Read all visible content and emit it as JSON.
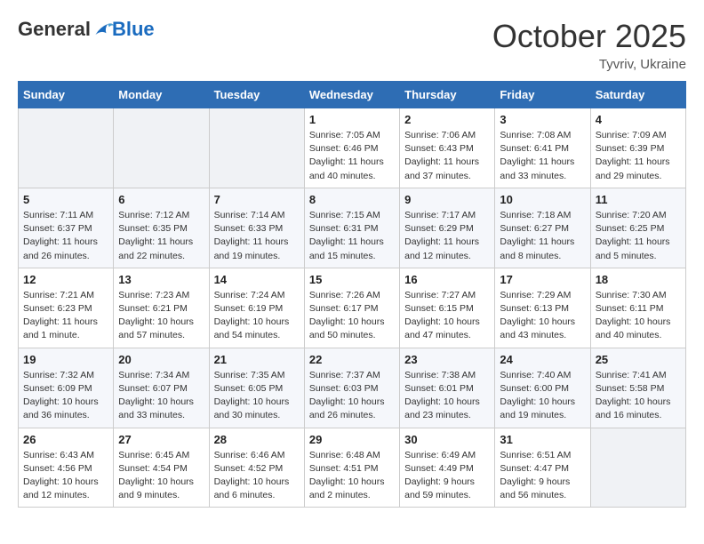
{
  "header": {
    "logo_general": "General",
    "logo_blue": "Blue",
    "month_year": "October 2025",
    "location": "Tyvriv, Ukraine"
  },
  "weekdays": [
    "Sunday",
    "Monday",
    "Tuesday",
    "Wednesday",
    "Thursday",
    "Friday",
    "Saturday"
  ],
  "weeks": [
    [
      {
        "day": "",
        "info": ""
      },
      {
        "day": "",
        "info": ""
      },
      {
        "day": "",
        "info": ""
      },
      {
        "day": "1",
        "info": "Sunrise: 7:05 AM\nSunset: 6:46 PM\nDaylight: 11 hours\nand 40 minutes."
      },
      {
        "day": "2",
        "info": "Sunrise: 7:06 AM\nSunset: 6:43 PM\nDaylight: 11 hours\nand 37 minutes."
      },
      {
        "day": "3",
        "info": "Sunrise: 7:08 AM\nSunset: 6:41 PM\nDaylight: 11 hours\nand 33 minutes."
      },
      {
        "day": "4",
        "info": "Sunrise: 7:09 AM\nSunset: 6:39 PM\nDaylight: 11 hours\nand 29 minutes."
      }
    ],
    [
      {
        "day": "5",
        "info": "Sunrise: 7:11 AM\nSunset: 6:37 PM\nDaylight: 11 hours\nand 26 minutes."
      },
      {
        "day": "6",
        "info": "Sunrise: 7:12 AM\nSunset: 6:35 PM\nDaylight: 11 hours\nand 22 minutes."
      },
      {
        "day": "7",
        "info": "Sunrise: 7:14 AM\nSunset: 6:33 PM\nDaylight: 11 hours\nand 19 minutes."
      },
      {
        "day": "8",
        "info": "Sunrise: 7:15 AM\nSunset: 6:31 PM\nDaylight: 11 hours\nand 15 minutes."
      },
      {
        "day": "9",
        "info": "Sunrise: 7:17 AM\nSunset: 6:29 PM\nDaylight: 11 hours\nand 12 minutes."
      },
      {
        "day": "10",
        "info": "Sunrise: 7:18 AM\nSunset: 6:27 PM\nDaylight: 11 hours\nand 8 minutes."
      },
      {
        "day": "11",
        "info": "Sunrise: 7:20 AM\nSunset: 6:25 PM\nDaylight: 11 hours\nand 5 minutes."
      }
    ],
    [
      {
        "day": "12",
        "info": "Sunrise: 7:21 AM\nSunset: 6:23 PM\nDaylight: 11 hours\nand 1 minute."
      },
      {
        "day": "13",
        "info": "Sunrise: 7:23 AM\nSunset: 6:21 PM\nDaylight: 10 hours\nand 57 minutes."
      },
      {
        "day": "14",
        "info": "Sunrise: 7:24 AM\nSunset: 6:19 PM\nDaylight: 10 hours\nand 54 minutes."
      },
      {
        "day": "15",
        "info": "Sunrise: 7:26 AM\nSunset: 6:17 PM\nDaylight: 10 hours\nand 50 minutes."
      },
      {
        "day": "16",
        "info": "Sunrise: 7:27 AM\nSunset: 6:15 PM\nDaylight: 10 hours\nand 47 minutes."
      },
      {
        "day": "17",
        "info": "Sunrise: 7:29 AM\nSunset: 6:13 PM\nDaylight: 10 hours\nand 43 minutes."
      },
      {
        "day": "18",
        "info": "Sunrise: 7:30 AM\nSunset: 6:11 PM\nDaylight: 10 hours\nand 40 minutes."
      }
    ],
    [
      {
        "day": "19",
        "info": "Sunrise: 7:32 AM\nSunset: 6:09 PM\nDaylight: 10 hours\nand 36 minutes."
      },
      {
        "day": "20",
        "info": "Sunrise: 7:34 AM\nSunset: 6:07 PM\nDaylight: 10 hours\nand 33 minutes."
      },
      {
        "day": "21",
        "info": "Sunrise: 7:35 AM\nSunset: 6:05 PM\nDaylight: 10 hours\nand 30 minutes."
      },
      {
        "day": "22",
        "info": "Sunrise: 7:37 AM\nSunset: 6:03 PM\nDaylight: 10 hours\nand 26 minutes."
      },
      {
        "day": "23",
        "info": "Sunrise: 7:38 AM\nSunset: 6:01 PM\nDaylight: 10 hours\nand 23 minutes."
      },
      {
        "day": "24",
        "info": "Sunrise: 7:40 AM\nSunset: 6:00 PM\nDaylight: 10 hours\nand 19 minutes."
      },
      {
        "day": "25",
        "info": "Sunrise: 7:41 AM\nSunset: 5:58 PM\nDaylight: 10 hours\nand 16 minutes."
      }
    ],
    [
      {
        "day": "26",
        "info": "Sunrise: 6:43 AM\nSunset: 4:56 PM\nDaylight: 10 hours\nand 12 minutes."
      },
      {
        "day": "27",
        "info": "Sunrise: 6:45 AM\nSunset: 4:54 PM\nDaylight: 10 hours\nand 9 minutes."
      },
      {
        "day": "28",
        "info": "Sunrise: 6:46 AM\nSunset: 4:52 PM\nDaylight: 10 hours\nand 6 minutes."
      },
      {
        "day": "29",
        "info": "Sunrise: 6:48 AM\nSunset: 4:51 PM\nDaylight: 10 hours\nand 2 minutes."
      },
      {
        "day": "30",
        "info": "Sunrise: 6:49 AM\nSunset: 4:49 PM\nDaylight: 9 hours\nand 59 minutes."
      },
      {
        "day": "31",
        "info": "Sunrise: 6:51 AM\nSunset: 4:47 PM\nDaylight: 9 hours\nand 56 minutes."
      },
      {
        "day": "",
        "info": ""
      }
    ]
  ]
}
